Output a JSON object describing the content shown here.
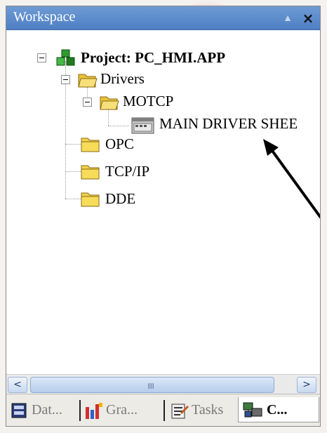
{
  "window": {
    "title": "Workspace",
    "pin_icon": "pin-icon",
    "close_label": "×"
  },
  "tree": {
    "project": {
      "label": "Project: PC_HMI.APP",
      "icon": "project-cubes-icon"
    },
    "drivers": {
      "label": "Drivers",
      "icon": "folder-open-icon"
    },
    "motcp": {
      "label": "MOTCP",
      "icon": "folder-open-icon"
    },
    "main_driver_sheet": {
      "label": "MAIN DRIVER SHEE",
      "icon": "driver-sheet-icon"
    },
    "opc": {
      "label": "OPC",
      "icon": "folder-icon"
    },
    "tcpip": {
      "label": "TCP/IP",
      "icon": "folder-icon"
    },
    "dde": {
      "label": "DDE",
      "icon": "folder-icon"
    }
  },
  "scrollbar": {
    "left_arrow": "<",
    "right_arrow": ">",
    "grip": "IIII"
  },
  "tabs": [
    {
      "label": "Dat...",
      "icon": "database-icon",
      "active": false
    },
    {
      "label": "Gra...",
      "icon": "graphics-icon",
      "active": false
    },
    {
      "label": "Tasks",
      "icon": "tasks-icon",
      "active": false
    },
    {
      "label": "C...",
      "icon": "comm-icon",
      "active": true
    }
  ],
  "colors": {
    "titlebar": "#5a88c8",
    "folder": "#f2d24c",
    "annotation_arrow": "#000000"
  }
}
